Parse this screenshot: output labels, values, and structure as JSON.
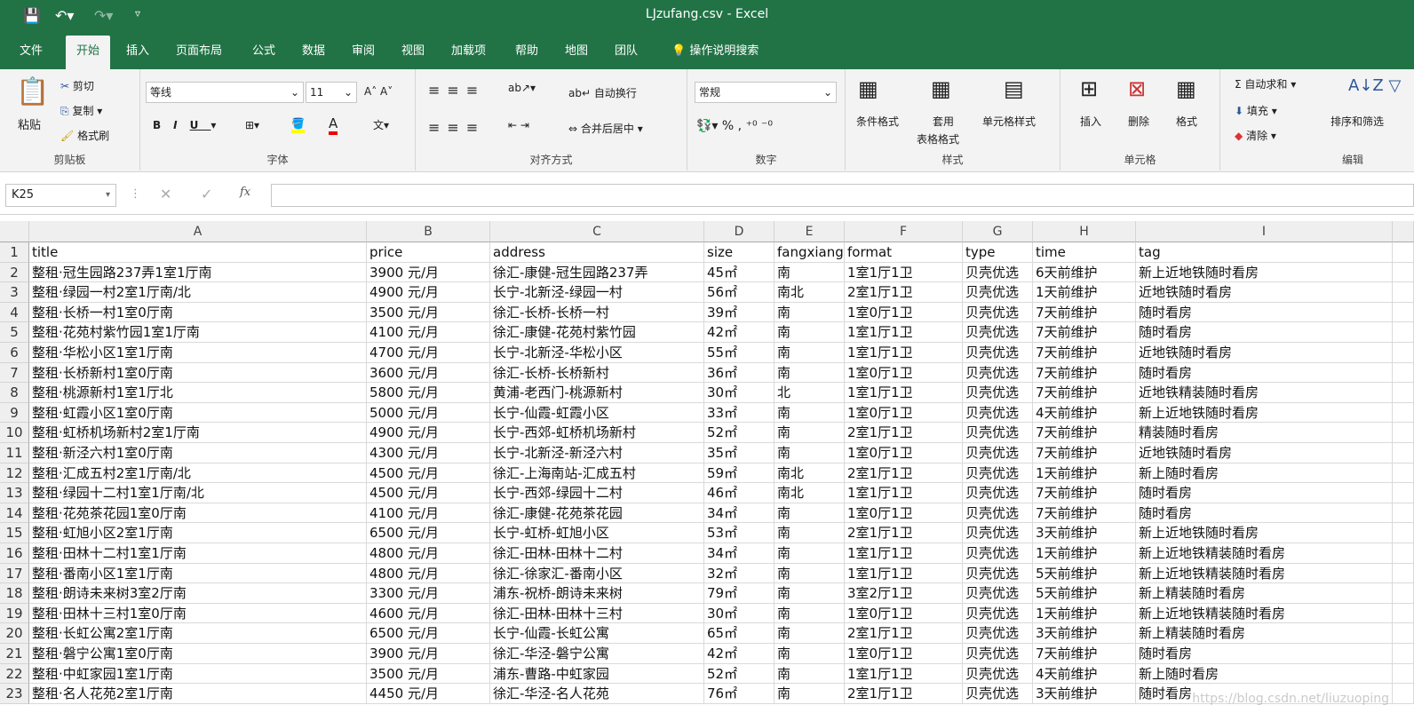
{
  "window": {
    "title": "LJzufang.csv  -  Excel"
  },
  "tabs": [
    "文件",
    "开始",
    "插入",
    "页面布局",
    "公式",
    "数据",
    "审阅",
    "视图",
    "加载项",
    "帮助",
    "地图",
    "团队"
  ],
  "active_tab": "开始",
  "tell_me": "操作说明搜索",
  "ribbon": {
    "clipboard": {
      "label": "剪贴板",
      "paste": "粘贴",
      "cut": "剪切",
      "copy": "复制",
      "format_painter": "格式刷"
    },
    "font": {
      "label": "字体",
      "font_name": "等线",
      "font_size": "11"
    },
    "alignment": {
      "label": "对齐方式",
      "wrap": "自动换行",
      "merge": "合并后居中"
    },
    "number": {
      "label": "数字",
      "format": "常规"
    },
    "styles": {
      "label": "样式",
      "conditional": "条件格式",
      "table_line1": "套用",
      "table_line2": "表格格式",
      "cell_styles": "单元格样式"
    },
    "cells": {
      "label": "单元格",
      "insert": "插入",
      "delete": "删除",
      "format": "格式"
    },
    "editing": {
      "label": "编辑",
      "autosum": "自动求和",
      "fill": "填充",
      "clear": "清除",
      "sort": "排序和筛选"
    }
  },
  "formula_bar": {
    "name_box": "K25",
    "fx": "fx",
    "value": ""
  },
  "columns": [
    "A",
    "B",
    "C",
    "D",
    "E",
    "F",
    "G",
    "H",
    "I"
  ],
  "rows": [
    [
      "title",
      "price",
      "address",
      "size",
      "fangxiang",
      "format",
      "type",
      "time",
      "tag"
    ],
    [
      "整租·冠生园路237弄1室1厅南",
      "3900 元/月",
      "徐汇-康健-冠生园路237弄",
      "45㎡",
      "南",
      "1室1厅1卫",
      "贝壳优选",
      "6天前维护",
      "新上近地铁随时看房"
    ],
    [
      "整租·绿园一村2室1厅南/北",
      "4900 元/月",
      "长宁-北新泾-绿园一村",
      "56㎡",
      "南北",
      "2室1厅1卫",
      "贝壳优选",
      "1天前维护",
      "近地铁随时看房"
    ],
    [
      "整租·长桥一村1室0厅南",
      "3500 元/月",
      "徐汇-长桥-长桥一村",
      "39㎡",
      "南",
      "1室0厅1卫",
      "贝壳优选",
      "7天前维护",
      "随时看房"
    ],
    [
      "整租·花苑村紫竹园1室1厅南",
      "4100 元/月",
      "徐汇-康健-花苑村紫竹园",
      "42㎡",
      "南",
      "1室1厅1卫",
      "贝壳优选",
      "7天前维护",
      "随时看房"
    ],
    [
      "整租·华松小区1室1厅南",
      "4700 元/月",
      "长宁-北新泾-华松小区",
      "55㎡",
      "南",
      "1室1厅1卫",
      "贝壳优选",
      "7天前维护",
      "近地铁随时看房"
    ],
    [
      "整租·长桥新村1室0厅南",
      "3600 元/月",
      "徐汇-长桥-长桥新村",
      "36㎡",
      "南",
      "1室0厅1卫",
      "贝壳优选",
      "7天前维护",
      "随时看房"
    ],
    [
      "整租·桃源新村1室1厅北",
      "5800 元/月",
      "黄浦-老西门-桃源新村",
      "30㎡",
      "北",
      "1室1厅1卫",
      "贝壳优选",
      "7天前维护",
      "近地铁精装随时看房"
    ],
    [
      "整租·虹霞小区1室0厅南",
      "5000 元/月",
      "长宁-仙霞-虹霞小区",
      "33㎡",
      "南",
      "1室0厅1卫",
      "贝壳优选",
      "4天前维护",
      "新上近地铁随时看房"
    ],
    [
      "整租·虹桥机场新村2室1厅南",
      "4900 元/月",
      "长宁-西郊-虹桥机场新村",
      "52㎡",
      "南",
      "2室1厅1卫",
      "贝壳优选",
      "7天前维护",
      "精装随时看房"
    ],
    [
      "整租·新泾六村1室0厅南",
      "4300 元/月",
      "长宁-北新泾-新泾六村",
      "35㎡",
      "南",
      "1室0厅1卫",
      "贝壳优选",
      "7天前维护",
      "近地铁随时看房"
    ],
    [
      "整租·汇成五村2室1厅南/北",
      "4500 元/月",
      "徐汇-上海南站-汇成五村",
      "59㎡",
      "南北",
      "2室1厅1卫",
      "贝壳优选",
      "1天前维护",
      "新上随时看房"
    ],
    [
      "整租·绿园十二村1室1厅南/北",
      "4500 元/月",
      "长宁-西郊-绿园十二村",
      "46㎡",
      "南北",
      "1室1厅1卫",
      "贝壳优选",
      "7天前维护",
      "随时看房"
    ],
    [
      "整租·花苑茶花园1室0厅南",
      "4100 元/月",
      "徐汇-康健-花苑茶花园",
      "34㎡",
      "南",
      "1室0厅1卫",
      "贝壳优选",
      "7天前维护",
      "随时看房"
    ],
    [
      "整租·虹旭小区2室1厅南",
      "6500 元/月",
      "长宁-虹桥-虹旭小区",
      "53㎡",
      "南",
      "2室1厅1卫",
      "贝壳优选",
      "3天前维护",
      "新上近地铁随时看房"
    ],
    [
      "整租·田林十二村1室1厅南",
      "4800 元/月",
      "徐汇-田林-田林十二村",
      "34㎡",
      "南",
      "1室1厅1卫",
      "贝壳优选",
      "1天前维护",
      "新上近地铁精装随时看房"
    ],
    [
      "整租·番南小区1室1厅南",
      "4800 元/月",
      "徐汇-徐家汇-番南小区",
      "32㎡",
      "南",
      "1室1厅1卫",
      "贝壳优选",
      "5天前维护",
      "新上近地铁精装随时看房"
    ],
    [
      "整租·朗诗未来树3室2厅南",
      "3300 元/月",
      "浦东-祝桥-朗诗未来树",
      "79㎡",
      "南",
      "3室2厅1卫",
      "贝壳优选",
      "5天前维护",
      "新上精装随时看房"
    ],
    [
      "整租·田林十三村1室0厅南",
      "4600 元/月",
      "徐汇-田林-田林十三村",
      "30㎡",
      "南",
      "1室0厅1卫",
      "贝壳优选",
      "1天前维护",
      "新上近地铁精装随时看房"
    ],
    [
      "整租·长虹公寓2室1厅南",
      "6500 元/月",
      "长宁-仙霞-长虹公寓",
      "65㎡",
      "南",
      "2室1厅1卫",
      "贝壳优选",
      "3天前维护",
      "新上精装随时看房"
    ],
    [
      "整租·磐宁公寓1室0厅南",
      "3900 元/月",
      "徐汇-华泾-磐宁公寓",
      "42㎡",
      "南",
      "1室0厅1卫",
      "贝壳优选",
      "7天前维护",
      "随时看房"
    ],
    [
      "整租·中虹家园1室1厅南",
      "3500 元/月",
      "浦东-曹路-中虹家园",
      "52㎡",
      "南",
      "1室1厅1卫",
      "贝壳优选",
      "4天前维护",
      "新上随时看房"
    ],
    [
      "整租·名人花苑2室1厅南",
      "4450 元/月",
      "徐汇-华泾-名人花苑",
      "76㎡",
      "南",
      "2室1厅1卫",
      "贝壳优选",
      "3天前维护",
      "随时看房"
    ]
  ],
  "watermark": "https://blog.csdn.net/liuzuoping",
  "colors": {
    "brand": "#217346",
    "ribbon_bg": "#f3f3f3"
  }
}
